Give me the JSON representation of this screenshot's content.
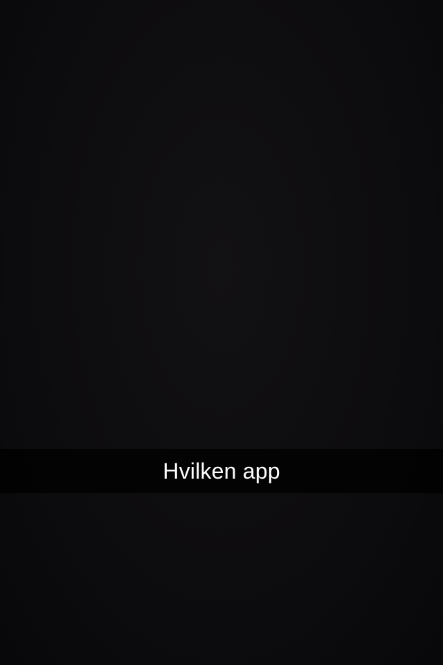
{
  "caption": {
    "text": "Hvilken app"
  },
  "colors": {
    "background": "#0b0a0c",
    "caption_bar": "#000000",
    "caption_text": "#ffffff"
  }
}
